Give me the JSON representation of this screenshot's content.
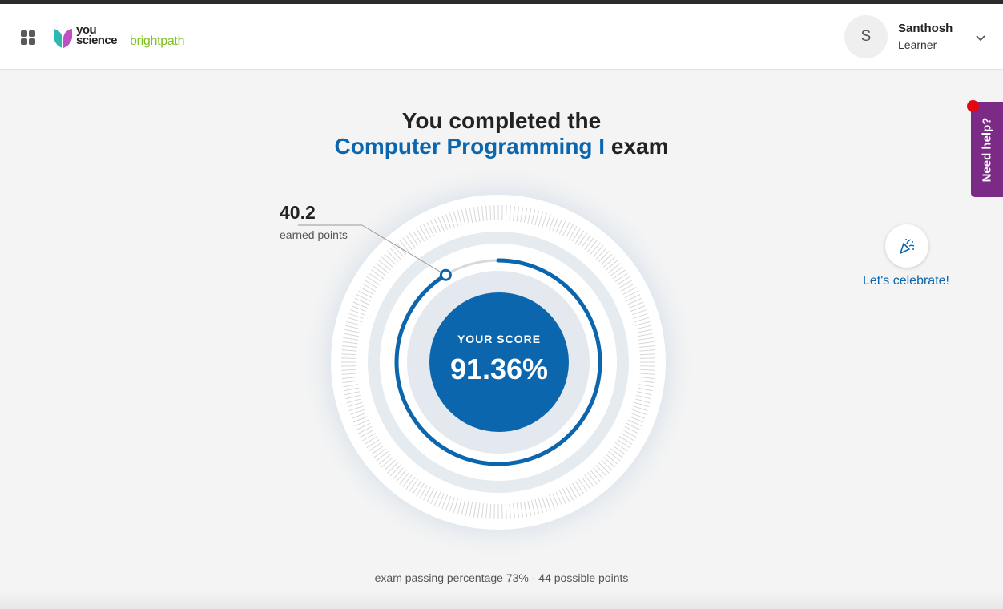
{
  "header": {
    "logo": {
      "word_1": "you",
      "word_2": "science",
      "word_3": "brightpath"
    },
    "user": {
      "initial": "S",
      "name": "Santhosh",
      "role": "Learner"
    }
  },
  "help": {
    "label": "Need help?"
  },
  "result": {
    "title_line_1": "You completed the",
    "course": "Computer Programming I",
    "title_suffix": " exam",
    "earned_points": "40.2",
    "earned_label": "earned points",
    "score_label": "YOUR SCORE",
    "score_value": "91.36%",
    "score_fraction": 0.9136,
    "passing_note": "exam passing percentage 73% - 44 possible points"
  },
  "celebrate": {
    "label": "Let's celebrate!",
    "icon": "party-popper-icon"
  },
  "colors": {
    "primary": "#0b66ad",
    "help_purple": "#7b2a86",
    "brand_green": "#7ec11f",
    "alert_red": "#e30613"
  }
}
